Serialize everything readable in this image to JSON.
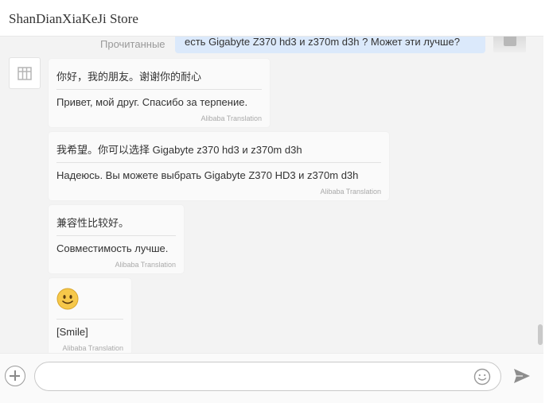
{
  "header": {
    "title": "ShanDianXiaKeJi Store"
  },
  "sent_message": {
    "status": "Прочитанные",
    "text": "есть Gigabyte Z370 hd3 и z370m d3h ? Может эти лучше?"
  },
  "messages": [
    {
      "original": "你好，我的朋友。谢谢你的耐心",
      "translation": "Привет, мой друг. Спасибо за терпение.",
      "credit": "Alibaba Translation"
    },
    {
      "original": "我希望。你可以选择 Gigabyte z370 hd3 и z370m d3h",
      "translation": "Надеюсь. Вы можете выбрать Gigabyte Z370 HD3 и z370m d3h",
      "credit": "Alibaba Translation"
    },
    {
      "original": "兼容性比较好。",
      "translation": "Совместимость лучше.",
      "credit": "Alibaba Translation"
    },
    {
      "emoji": "smile-emoji",
      "translation": "[Smile]",
      "credit": "Alibaba Translation"
    }
  ],
  "composer": {
    "placeholder": ""
  },
  "icons": {
    "store_avatar": "store-icon",
    "plus": "plus-icon",
    "emoji": "smiley-icon",
    "send": "send-icon"
  },
  "colors": {
    "sent_bubble": "#dbe9fb",
    "received_bubble": "#fafafa",
    "background": "#f3f3f3"
  }
}
